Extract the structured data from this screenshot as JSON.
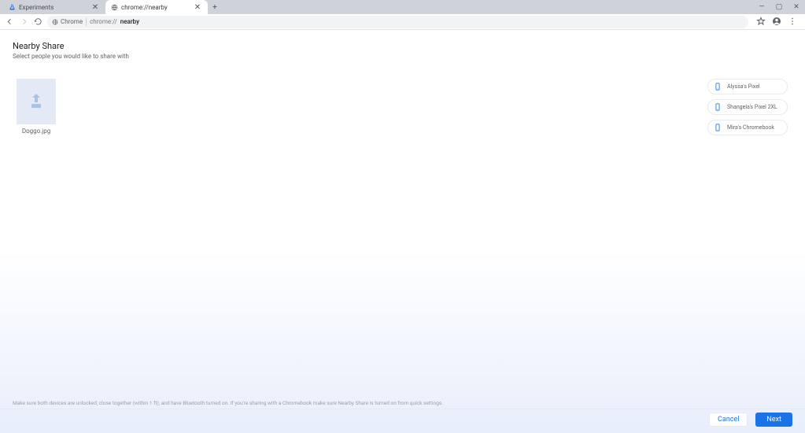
{
  "tabs": {
    "items": [
      {
        "label": "Experiments",
        "favicon": "flask"
      },
      {
        "label": "chrome://nearby",
        "favicon": "globe"
      }
    ]
  },
  "omnibox": {
    "chip_icon": "globe",
    "chip_label": "Chrome",
    "url_muted": "chrome://",
    "url_path": "nearby"
  },
  "page": {
    "title": "Nearby Share",
    "subtitle": "Select people you would like to share with",
    "file": {
      "name": "Doggo.jpg"
    },
    "devices": [
      {
        "label": "Alyssa's Pixel"
      },
      {
        "label": "Shangela's Pixel 2XL"
      },
      {
        "label": "Mira's Chromebook"
      }
    ],
    "hint": "Make sure both devices are unlocked, close together (within 1 ft), and have Bluetooth turned on. If you're sharing with a Chromebook make sure Nearby Share is turned on from quick settings.",
    "cancel_label": "Cancel",
    "next_label": "Next"
  }
}
